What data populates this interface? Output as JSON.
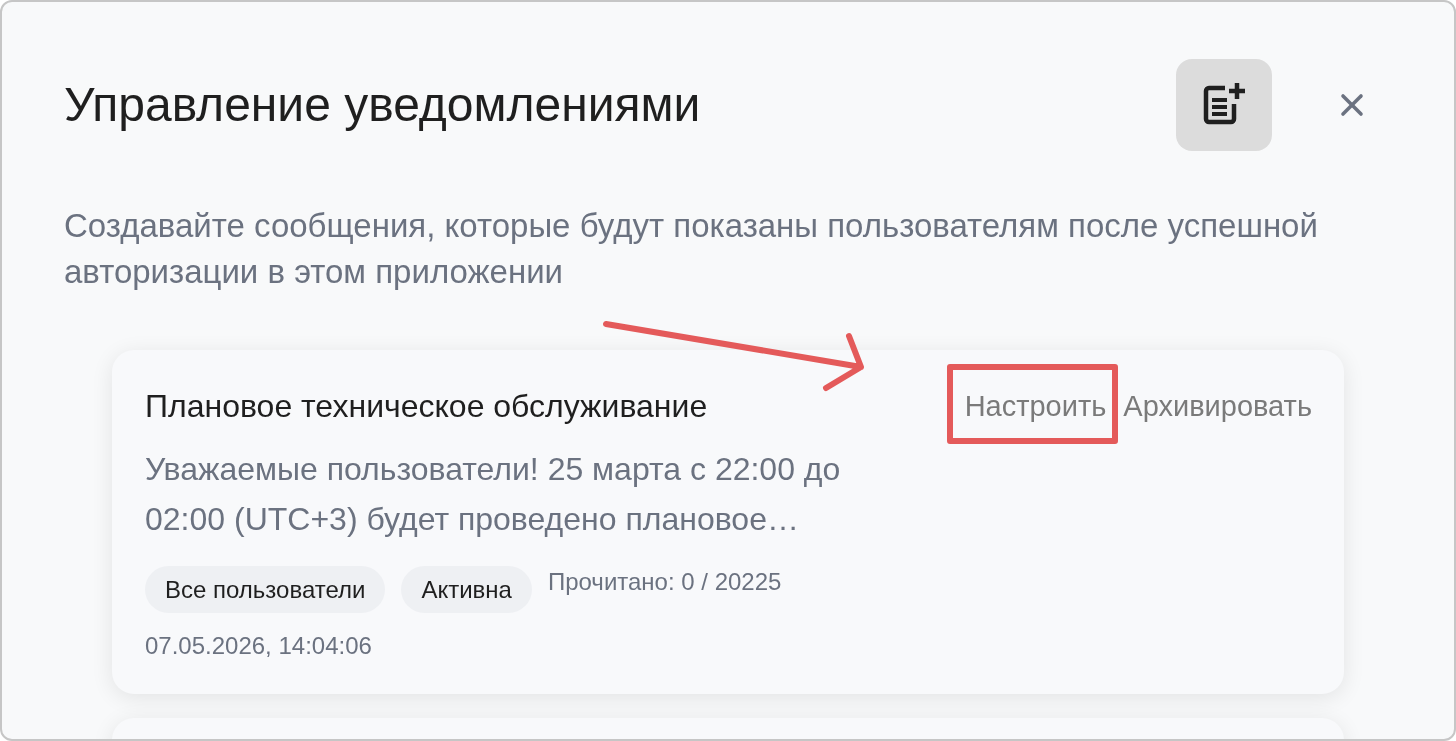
{
  "dialog": {
    "title": "Управление уведомлениями",
    "description": "Создавайте сообщения, которые будут показаны пользователям после успешной авторизации в этом приложении"
  },
  "notifications": [
    {
      "title": "Плановое техническое обслуживание",
      "body": "Уважаемые пользователи! 25 марта с 22:00 до 02:00 (UTC+3) будет проведено плановое…",
      "tags": [
        "Все пользователи",
        "Активна"
      ],
      "read_count": "Прочитано: 0 / 20225",
      "date": "07.05.2026, 14:04:06",
      "actions": [
        {
          "label": "Настроить",
          "highlighted": true
        },
        {
          "label": "Архивировать",
          "highlighted": false
        }
      ]
    }
  ],
  "annotation_arrow": true
}
